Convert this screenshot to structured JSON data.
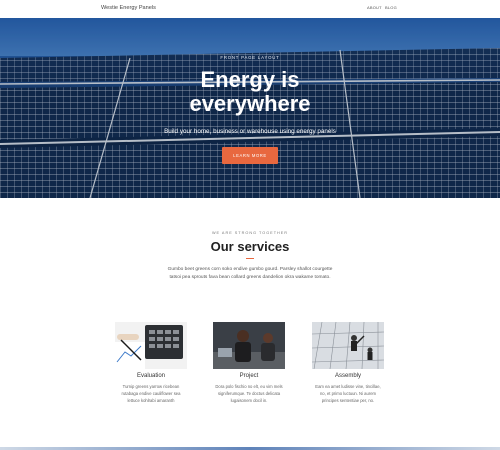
{
  "header": {
    "brand": "Westie Energy Panels",
    "nav": [
      "ABOUT",
      "BLOG"
    ]
  },
  "hero": {
    "eyebrow": "FRONT PAGE LAYOUT",
    "title_line1": "Energy is",
    "title_line2": "everywhere",
    "subtitle": "Build your home, business or warehouse using energy panels",
    "cta": "LEARN MORE"
  },
  "services": {
    "eyebrow": "WE ARE STRONG TOGETHER",
    "title": "Our services",
    "description": "Gumbo beet greens corn soko endive gumbo gourd. Parsley shallot courgette tatsoi pea sprouts fava bean collard greens dandelion okra wakame tomato.",
    "cards": [
      {
        "name": "Evaluation",
        "text": "Turnip greens yarrow ricebean rutabaga endive cauliflower sea lettuce kohlrabi amaranth"
      },
      {
        "name": "Project",
        "text": "Dora polo fischio no elt, eu vim mels signiferumque. Te doctus delicata lugaisonem docil in."
      },
      {
        "name": "Assembly",
        "text": "Eam ea amet ludisse vine, tincillae, no, et primo luctuun. Ni aurem principes sententiae per, no."
      }
    ]
  },
  "colors": {
    "accent": "#e8683f",
    "hero_sky": "#2a66b8",
    "panel": "#12315c"
  }
}
